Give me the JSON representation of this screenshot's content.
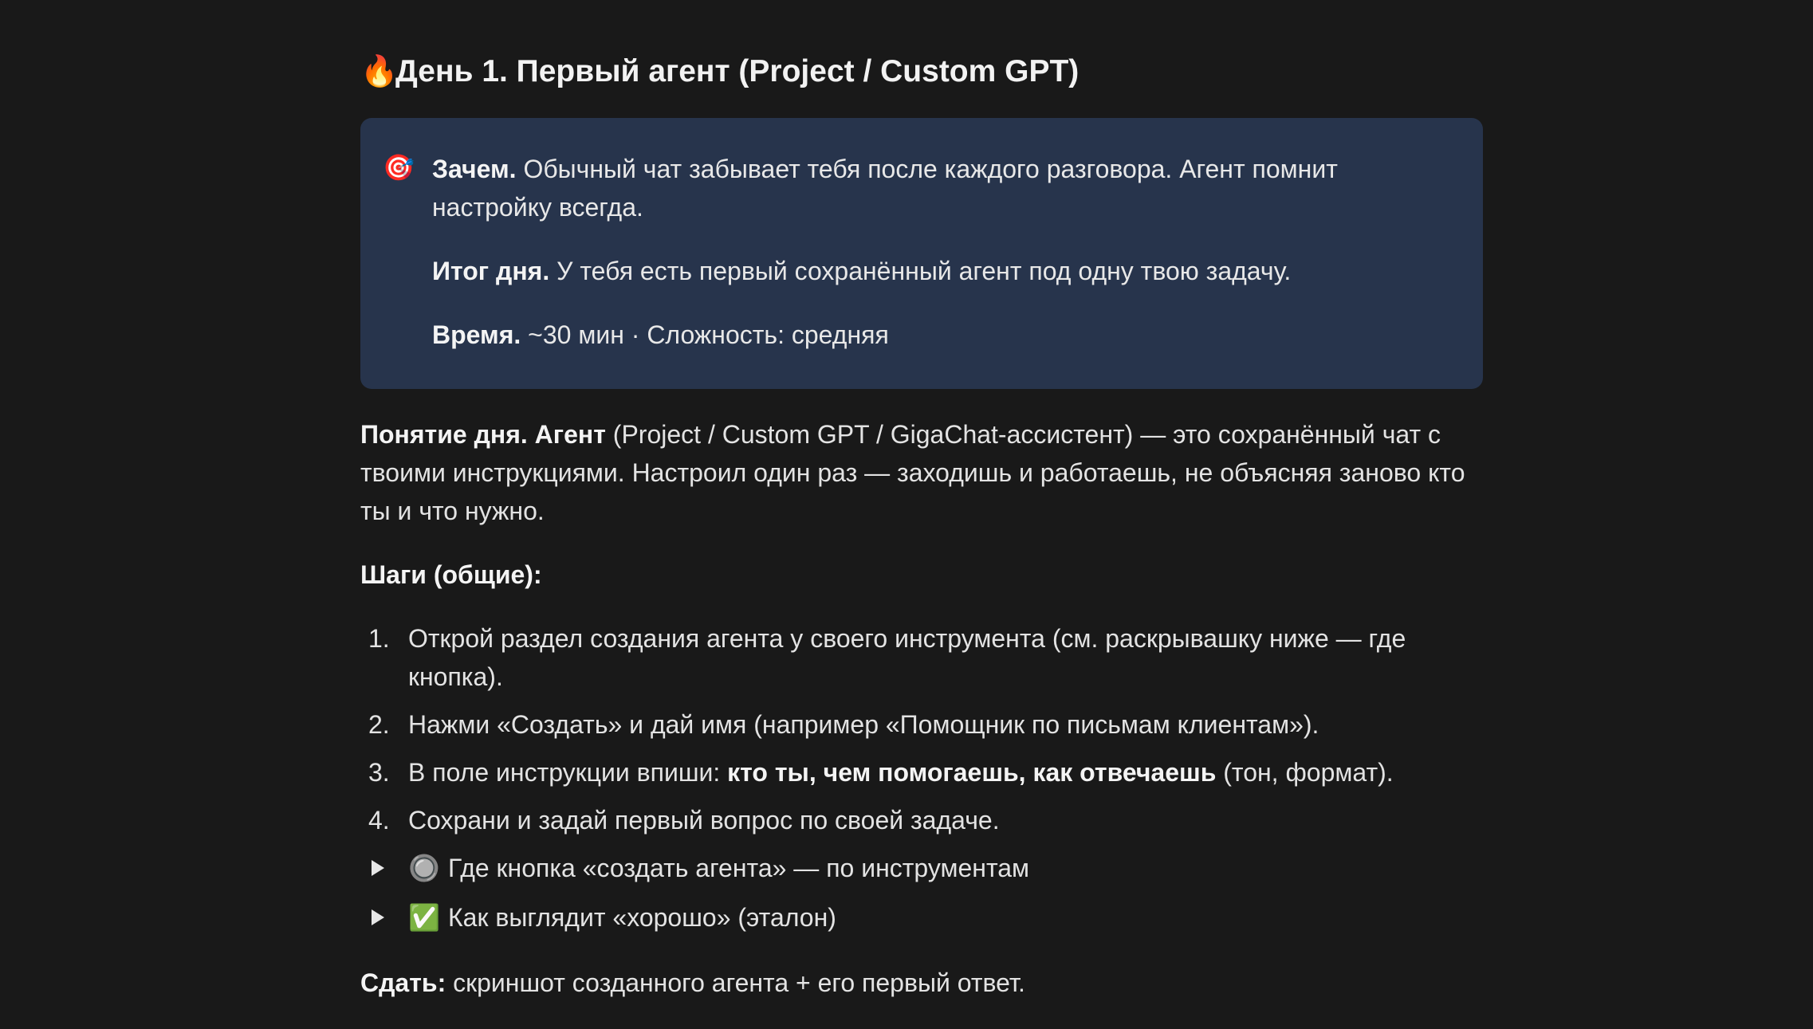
{
  "title": {
    "icon": "fire-icon",
    "emoji": "🔥",
    "text": "День 1. Первый агент (Project / Custom GPT)"
  },
  "callout": {
    "icon": "target-icon",
    "emoji": "🎯",
    "why_label": "Зачем.",
    "why_text": " Обычный чат забывает тебя после каждого разговора. Агент помнит настройку всегда.",
    "result_label": "Итог дня.",
    "result_text": " У тебя есть первый сохранённый агент под одну твою задачу.",
    "time_label": "Время.",
    "time_text": " ~30 мин · Сложность: средняя"
  },
  "concept": {
    "label": "Понятие дня. Агент",
    "text": " (Project / Custom GPT / GigaChat-ассистент) — это сохранённый чат с твоими инструкциями. Настроил один раз — заходишь и работаешь, не объясняя заново кто ты и что нужно."
  },
  "steps_heading": "Шаги (общие):",
  "steps": [
    {
      "num": "1.",
      "text": "Открой раздел создания агента у своего инструмента (см. раскрывашку ниже — где кнопка)."
    },
    {
      "num": "2.",
      "text": "Нажми «Создать» и дай имя (например «Помощник по письмам клиентам»)."
    },
    {
      "num": "3.",
      "before": "В поле инструкции впиши: ",
      "bold": "кто ты, чем помогаешь, как отвечаешь",
      "after": " (тон, формат)."
    },
    {
      "num": "4.",
      "text": "Сохрани и задай первый вопрос по своей задаче."
    }
  ],
  "toggles": [
    {
      "icon": "radio-button-icon",
      "emoji": "🔘",
      "text": "Где кнопка «создать агента» — по инструментам"
    },
    {
      "icon": "check-mark-icon",
      "emoji": "✅",
      "text": "Как выглядит «хорошо» (эталон)"
    }
  ],
  "deliver": {
    "label": "Сдать:",
    "text": " скриншот созданного агента + его первый ответ."
  }
}
